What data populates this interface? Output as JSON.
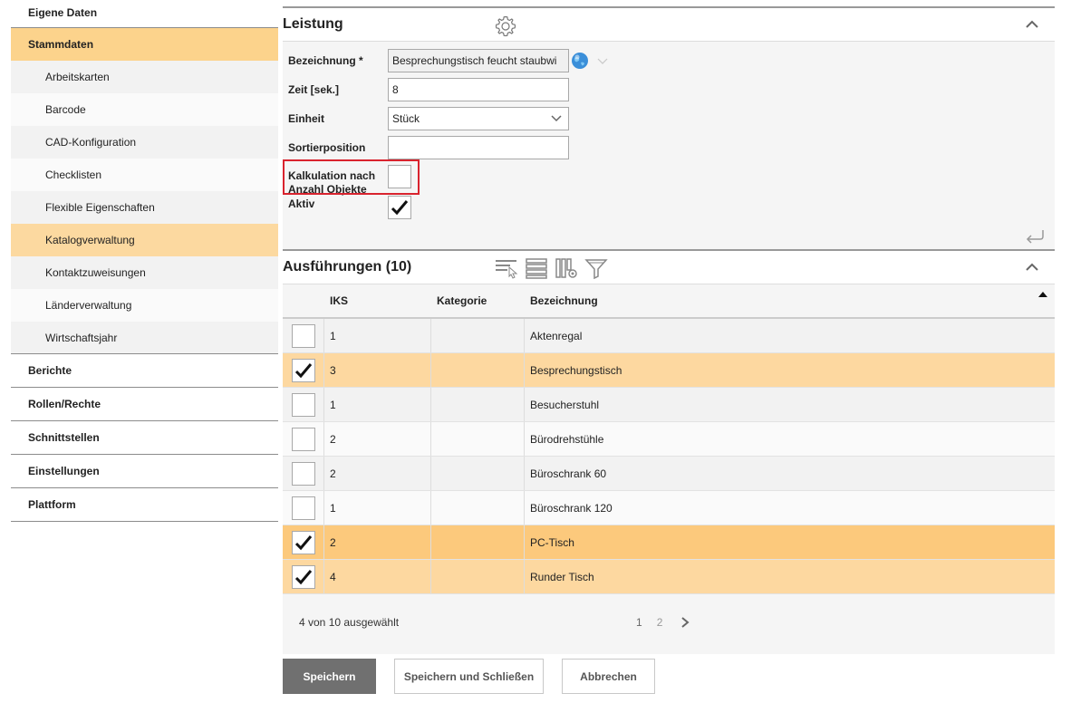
{
  "sidebar": {
    "items": [
      {
        "label": "Eigene Daten"
      },
      {
        "label": "Stammdaten"
      },
      {
        "label": "Berichte"
      },
      {
        "label": "Rollen/Rechte"
      },
      {
        "label": "Schnittstellen"
      },
      {
        "label": "Einstellungen"
      },
      {
        "label": "Plattform"
      }
    ],
    "subitems": [
      {
        "label": "Arbeitskarten"
      },
      {
        "label": "Barcode"
      },
      {
        "label": "CAD-Konfiguration"
      },
      {
        "label": "Checklisten"
      },
      {
        "label": "Flexible Eigenschaften"
      },
      {
        "label": "Katalogverwaltung"
      },
      {
        "label": "Kontaktzuweisungen"
      },
      {
        "label": "Länderverwaltung"
      },
      {
        "label": "Wirtschaftsjahr"
      }
    ]
  },
  "leistung": {
    "title": "Leistung",
    "fields": {
      "bezeichnung_label": "Bezeichnung *",
      "bezeichnung_value": "Besprechungstisch feucht staubwi",
      "zeit_label": "Zeit [sek.]",
      "zeit_value": "8",
      "einheit_label": "Einheit",
      "einheit_value": "Stück",
      "sortierposition_label": "Sortierposition",
      "sortierposition_value": "",
      "kalkulation_label_line1": "Kalkulation nach",
      "kalkulation_label_line2": "Anzahl Objekte",
      "kalkulation_checked": false,
      "aktiv_label": "Aktiv",
      "aktiv_checked": true
    }
  },
  "ausfuehrungen": {
    "title": "Ausführungen (10)",
    "columns": {
      "iks": "IKS",
      "kategorie": "Kategorie",
      "bezeichnung": "Bezeichnung"
    },
    "rows": [
      {
        "checked": false,
        "iks": "1",
        "kategorie": "",
        "bezeichnung": "Aktenregal"
      },
      {
        "checked": true,
        "iks": "3",
        "kategorie": "",
        "bezeichnung": "Besprechungstisch"
      },
      {
        "checked": false,
        "iks": "1",
        "kategorie": "",
        "bezeichnung": "Besucherstuhl"
      },
      {
        "checked": false,
        "iks": "2",
        "kategorie": "",
        "bezeichnung": "Bürodrehstühle"
      },
      {
        "checked": false,
        "iks": "2",
        "kategorie": "",
        "bezeichnung": "Büroschrank 60"
      },
      {
        "checked": false,
        "iks": "1",
        "kategorie": "",
        "bezeichnung": "Büroschrank 120"
      },
      {
        "checked": true,
        "iks": "2",
        "kategorie": "",
        "bezeichnung": "PC-Tisch"
      },
      {
        "checked": true,
        "iks": "4",
        "kategorie": "",
        "bezeichnung": "Runder Tisch"
      }
    ],
    "status": "4 von 10 ausgewählt",
    "pages": [
      "1",
      "2"
    ],
    "next_icon": "chevron-right-icon"
  },
  "buttons": {
    "save": "Speichern",
    "save_close": "Speichern und Schließen",
    "cancel": "Abbrechen"
  },
  "colors": {
    "active_nav": "#fcd38c",
    "selected_row": "#fdd8a0",
    "primary_button": "#707070",
    "highlight_border": "#d9232e"
  }
}
